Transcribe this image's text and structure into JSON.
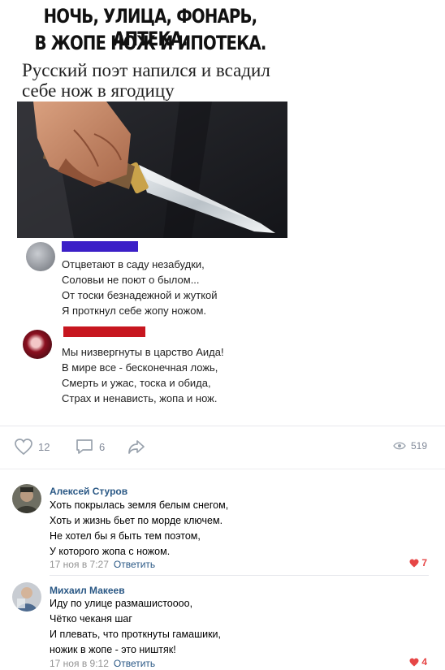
{
  "meme": {
    "headline_line1": "НОЧЬ, УЛИЦА, ФОНАРЬ, АПТЕКА.",
    "headline_line2": "В ЖОПЕ НОЖ И ИПОТЕКА.",
    "subtitle": "Русский поэт напился и всадил себе нож в ягодицу",
    "poem1": [
      "Отцветают в саду незабудки,",
      "Соловьи не поют о былом...",
      "От тоски безнадежной и жуткой",
      "Я проткнул себе жопу ножом."
    ],
    "poem2": [
      "Мы низвергнуты в царство Аида!",
      "В мире все - бесконечная ложь,",
      "Смерть и ужас, тоска и обида,",
      "Страх и ненависть, жопа и нож."
    ]
  },
  "colors": {
    "redact_blue": "#3b1fc7",
    "redact_red": "#c7161f",
    "link": "#2a5885",
    "like": "#e64646",
    "muted": "#828a99"
  },
  "actions": {
    "likes": "12",
    "comments": "6",
    "views": "519"
  },
  "comments": [
    {
      "author": "Алексей Стуров",
      "lines": [
        "Хоть покрылась земля белым снегом,",
        "Хоть и жизнь бьет по морде ключем.",
        "Не хотел бы я быть тем поэтом,",
        "У которого жопа с ножом."
      ],
      "date": "17 ноя в 7:27",
      "reply": "Ответить",
      "likes": "7"
    },
    {
      "author": "Михаил Макеев",
      "lines": [
        "Иду по улице размашистоооо,",
        "Чётко чеканя шаг",
        "И плевать, что проткнуты гамашики,",
        "ножик в жопе - это ништяк!"
      ],
      "date": "17 ноя в 9:12",
      "reply": "Ответить",
      "likes": "4"
    }
  ]
}
